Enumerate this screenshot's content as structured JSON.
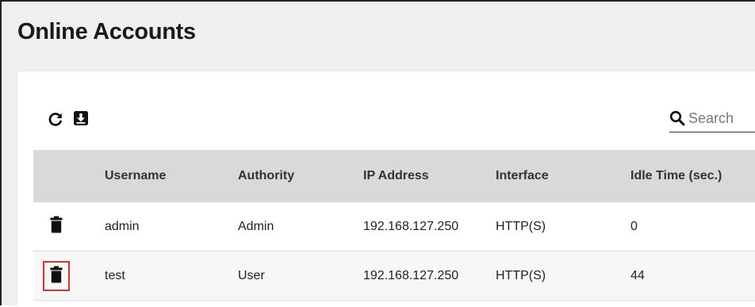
{
  "page": {
    "title": "Online Accounts"
  },
  "toolbar": {
    "refresh_icon": "refresh-icon",
    "export_icon": "download-icon"
  },
  "search": {
    "placeholder": "Search",
    "icon": "search-icon"
  },
  "table": {
    "columns": [
      "Username",
      "Authority",
      "IP Address",
      "Interface",
      "Idle Time (sec.)"
    ],
    "rows": [
      {
        "username": "admin",
        "authority": "Admin",
        "ip_address": "192.168.127.250",
        "interface": "HTTP(S)",
        "idle_time": "0"
      },
      {
        "username": "test",
        "authority": "User",
        "ip_address": "192.168.127.250",
        "interface": "HTTP(S)",
        "idle_time": "44"
      }
    ],
    "delete_icon": "trash-icon"
  },
  "colors": {
    "highlight": "#e0302a",
    "header_bg": "#d9d9d9",
    "page_bg": "#efefef"
  }
}
